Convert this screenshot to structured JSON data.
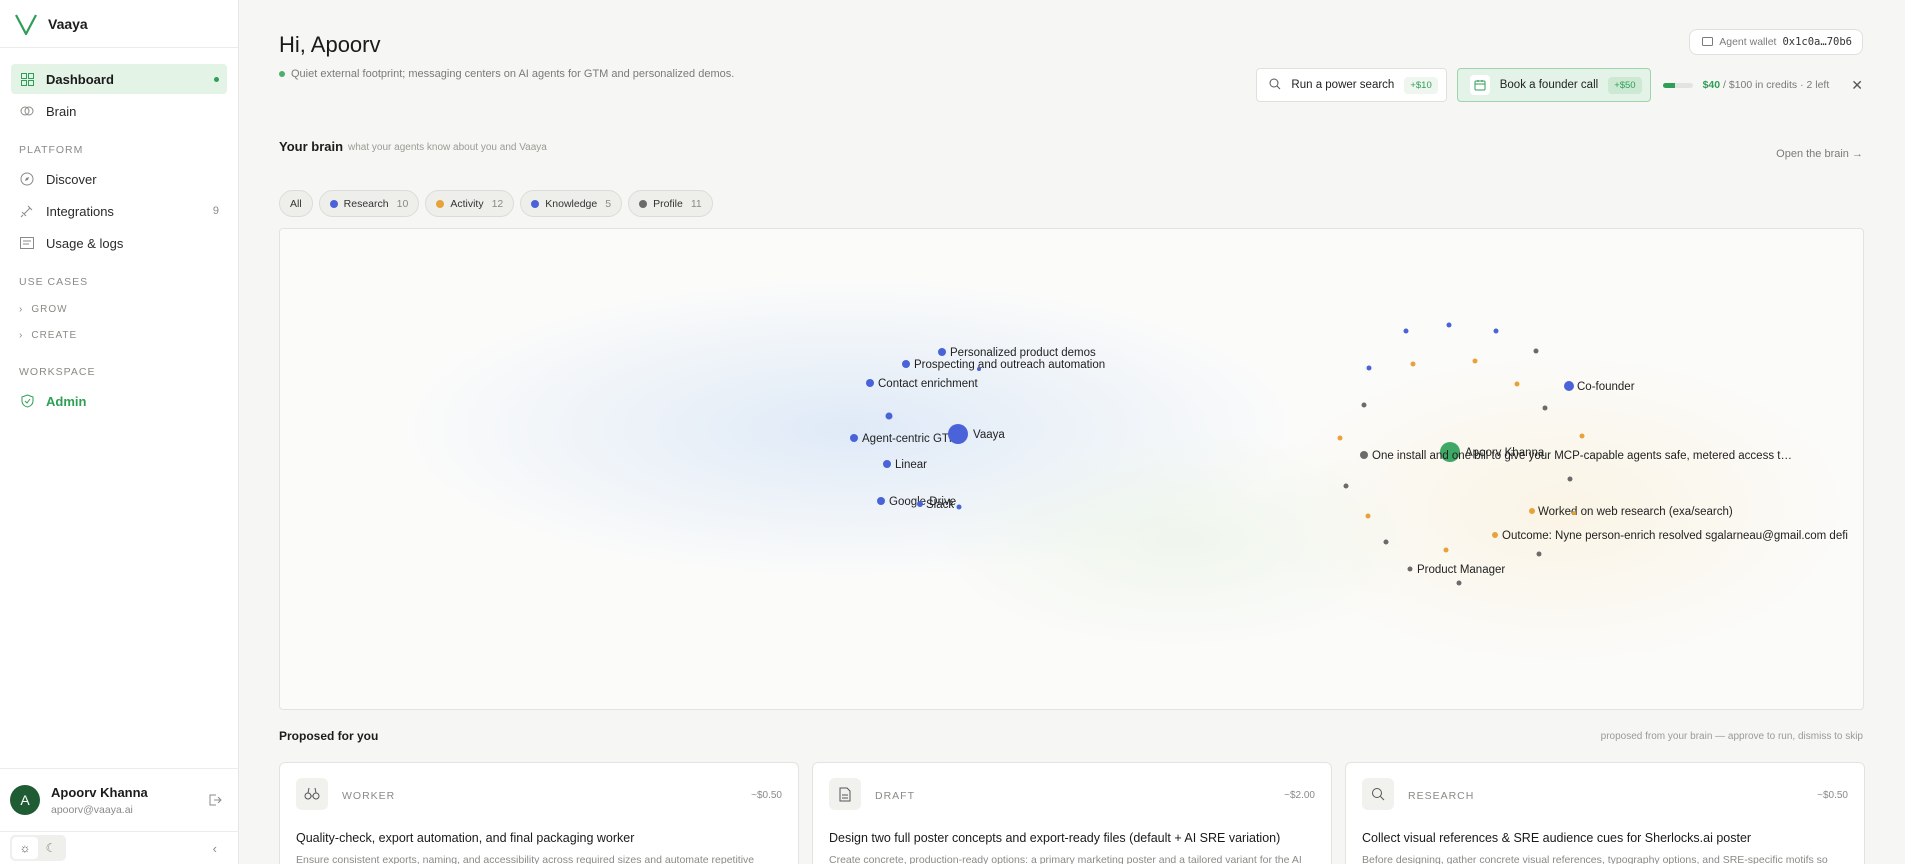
{
  "brand": {
    "name": "Vaaya"
  },
  "nav": {
    "dashboard": "Dashboard",
    "brain": "Brain",
    "platform_label": "PLATFORM",
    "discover": "Discover",
    "integrations": "Integrations",
    "integrations_count": "9",
    "usage": "Usage & logs",
    "use_cases_label": "USE CASES",
    "grow": "GROW",
    "create": "CREATE",
    "workspace_label": "WORKSPACE",
    "admin": "Admin"
  },
  "user": {
    "initial": "A",
    "name": "Apoorv Khanna",
    "email": "apoorv@vaaya.ai"
  },
  "header": {
    "greeting": "Hi, Apoorv",
    "subline": "Quiet external footprint; messaging centers on AI agents for GTM and personalized demos.",
    "wallet_label": "Agent wallet",
    "wallet_address": "0x1c0a…70b6",
    "power_search": "Run a power search",
    "power_search_reward": "+$10",
    "founder_call": "Book a founder call",
    "founder_call_reward": "+$50",
    "credits_used": "$40",
    "credits_rest": " / $100 in credits · 2 left",
    "credits_fraction": 0.4
  },
  "brain": {
    "title": "Your brain",
    "subtitle": "what your agents know about you and Vaaya",
    "open_link": "Open the brain →",
    "filters": [
      {
        "label": "All",
        "count": "",
        "color": ""
      },
      {
        "label": "Research",
        "count": "10",
        "color": "#4a63d8"
      },
      {
        "label": "Activity",
        "count": "12",
        "color": "#e8a23a"
      },
      {
        "label": "Knowledge",
        "count": "5",
        "color": "#4a63d8"
      },
      {
        "label": "Profile",
        "count": "11",
        "color": "#6b6b6b"
      }
    ],
    "labels": {
      "personalized_demos": "Personalized product demos",
      "prospecting": "Prospecting and outreach automation",
      "contact_enrichment": "Contact enrichment",
      "agent_gtm": "Agent-centric GTM",
      "vaaya": "Vaaya",
      "linear": "Linear",
      "google_drive": "Google Drive",
      "slack": "Slack",
      "cofounder": "Co-founder",
      "apoorv": "Apoorv Khanna",
      "one_install": "One install and one bill to give your MCP-capable agents safe, metered access t…",
      "web_research": "Worked on web research (exa/search)",
      "outcome": "Outcome: Nyne person-enrich resolved sgalarneau@gmail.com defi",
      "product_manager": "Product Manager"
    }
  },
  "proposed": {
    "title": "Proposed for you",
    "subtitle": "proposed from your brain — approve to run, dismiss to skip",
    "cards": [
      {
        "kind": "WORKER",
        "price": "~$0.50",
        "title": "Quality-check, export automation, and final packaging worker",
        "desc": "Ensure consistent exports, naming, and accessibility across required sizes and automate repetitive"
      },
      {
        "kind": "DRAFT",
        "price": "~$2.00",
        "title": "Design two full poster concepts and export-ready files (default + AI SRE variation)",
        "desc": "Create concrete, production-ready options: a primary marketing poster and a tailored variant for the AI"
      },
      {
        "kind": "RESEARCH",
        "price": "~$0.50",
        "title": "Collect visual references & SRE audience cues for Sherlocks.ai poster",
        "desc": "Before designing, gather concrete visual references, typography options, and SRE-specific motifs so"
      }
    ]
  },
  "colors": {
    "accent": "#2f9e57",
    "research": "#4a63d8",
    "activity": "#e8a23a",
    "profile": "#6b6b6b"
  }
}
